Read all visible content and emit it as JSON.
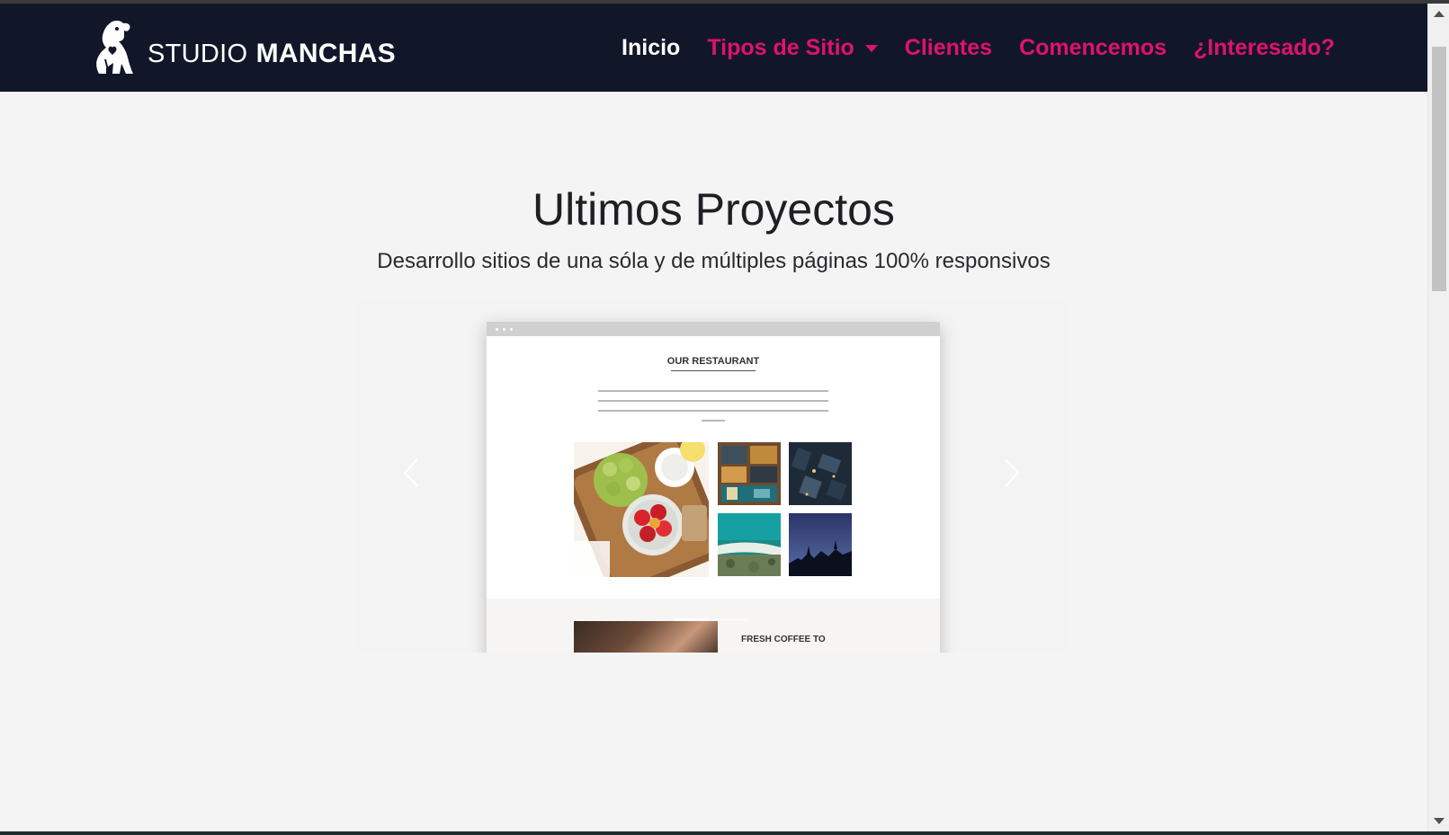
{
  "brand": {
    "name_light": "STUDIO",
    "name_bold": "MANCHAS",
    "logo_icon": "dog-logo-icon"
  },
  "nav": {
    "items": [
      {
        "label": "Inicio",
        "active": true
      },
      {
        "label": "Tipos de Sitio",
        "has_dropdown": true
      },
      {
        "label": "Clientes"
      },
      {
        "label": "Comencemos"
      },
      {
        "label": "¿Interesado?"
      }
    ]
  },
  "section": {
    "title": "Ultimos Proyectos",
    "subtitle": "Desarrollo sitios de una sóla y de múltiples páginas 100% responsivos"
  },
  "carousel": {
    "slide": {
      "heading": "OUR RESTAURANT",
      "lower_heading": "FRESH COFFEE TO"
    },
    "indicator_count": 2,
    "active_indicator": 0
  },
  "colors": {
    "navbar_bg": "#111729",
    "accent": "#e0126e",
    "page_bg": "#f4f4f4"
  }
}
